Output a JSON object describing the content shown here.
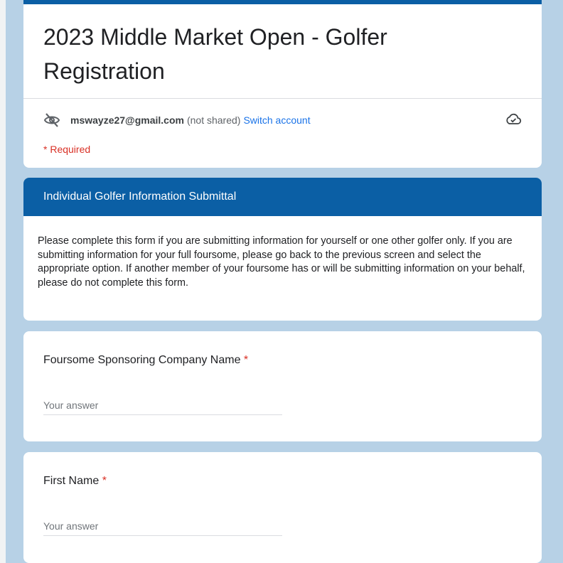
{
  "form": {
    "title": "2023 Middle Market Open - Golfer Registration",
    "account": {
      "email": "mswayze27@gmail.com",
      "not_shared": "(not shared)",
      "switch_label": "Switch account"
    },
    "required_note": "* Required",
    "icons": {
      "visibility": "eye-off-icon",
      "cloud": "cloud-check-icon"
    }
  },
  "section": {
    "title": "Individual Golfer Information Submittal",
    "description": "Please complete this form if you are submitting information for yourself or one other golfer only. If you are submitting information for your full foursome, please go back to the previous screen and select the appropriate option. If another member of your foursome has or will be submitting information on your behalf, please do not complete this form."
  },
  "questions": [
    {
      "label": "Foursome Sponsoring Company Name",
      "required_marker": "*",
      "placeholder": "Your answer",
      "value": ""
    },
    {
      "label": "First Name",
      "required_marker": "*",
      "placeholder": "Your answer",
      "value": ""
    }
  ],
  "colors": {
    "accent": "#0b5fa5",
    "background": "#b7d1e6",
    "required": "#d93025",
    "link": "#1a73e8"
  }
}
